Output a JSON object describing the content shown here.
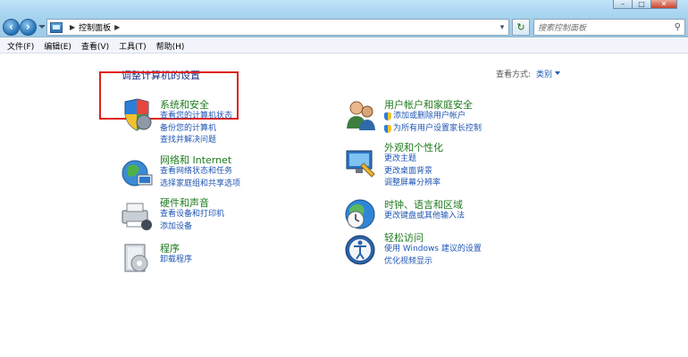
{
  "window": {
    "breadcrumb_root": "控制面板",
    "search_placeholder": "搜索控制面板"
  },
  "menu": [
    "文件(F)",
    "编辑(E)",
    "查看(V)",
    "工具(T)",
    "帮助(H)"
  ],
  "page": {
    "title": "调整计算机的设置",
    "view_by_label": "查看方式:",
    "view_by_value": "类别"
  },
  "categories": {
    "system_security": {
      "title": "系统和安全",
      "links": [
        "查看您的计算机状态",
        "备份您的计算机",
        "查找并解决问题"
      ]
    },
    "network": {
      "title": "网络和 Internet",
      "links": [
        "查看网络状态和任务",
        "选择家庭组和共享选项"
      ]
    },
    "hardware_sound": {
      "title": "硬件和声音",
      "links": [
        "查看设备和打印机",
        "添加设备"
      ]
    },
    "programs": {
      "title": "程序",
      "links": [
        "卸载程序"
      ]
    },
    "user_accounts": {
      "title": "用户帐户和家庭安全",
      "links": [
        "添加或删除用户帐户",
        "为所有用户设置家长控制"
      ]
    },
    "appearance": {
      "title": "外观和个性化",
      "links": [
        "更改主题",
        "更改桌面背景",
        "调整屏幕分辨率"
      ]
    },
    "clock_region": {
      "title": "时钟、语言和区域",
      "links": [
        "更改键盘或其他输入法"
      ]
    },
    "ease_of_access": {
      "title": "轻松访问",
      "links": [
        "使用 Windows 建议的设置",
        "优化视频显示"
      ]
    }
  }
}
